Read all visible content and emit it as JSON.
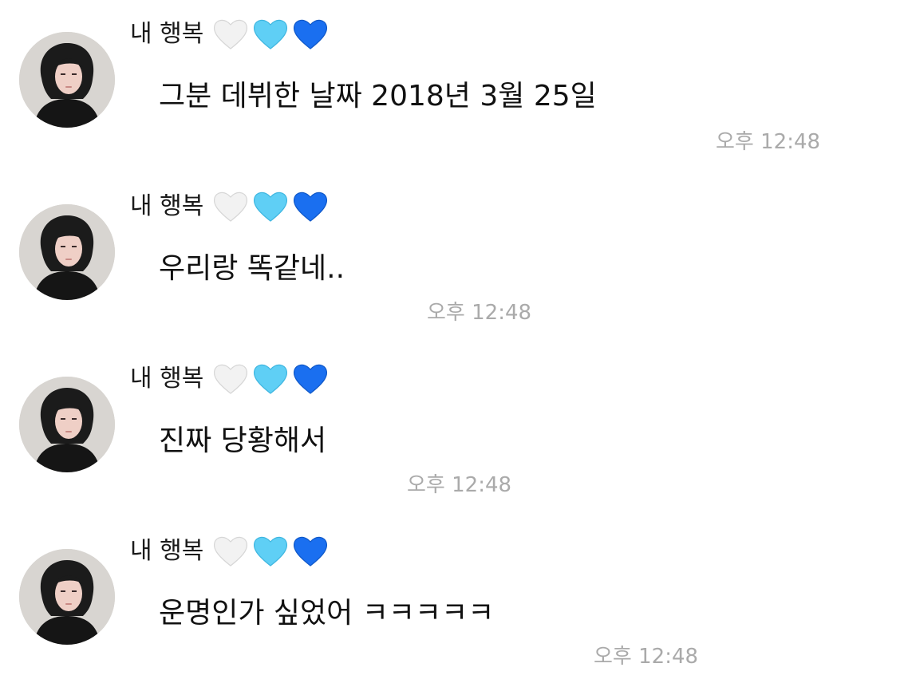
{
  "messages": [
    {
      "sender": "내 행복",
      "hearts": [
        "white-heart-icon",
        "light-blue-heart-icon",
        "blue-heart-icon"
      ],
      "text": "그분 데뷔한 날짜 2018년 3월 25일",
      "time": "오후 12:48"
    },
    {
      "sender": "내 행복",
      "hearts": [
        "white-heart-icon",
        "light-blue-heart-icon",
        "blue-heart-icon"
      ],
      "text": "우리랑 똑같네..",
      "time": "오후 12:48"
    },
    {
      "sender": "내 행복",
      "hearts": [
        "white-heart-icon",
        "light-blue-heart-icon",
        "blue-heart-icon"
      ],
      "text": "진짜 당황해서",
      "time": "오후 12:48"
    },
    {
      "sender": "내 행복",
      "hearts": [
        "white-heart-icon",
        "light-blue-heart-icon",
        "blue-heart-icon"
      ],
      "text": "운명인가 싶었어 ㅋㅋㅋㅋㅋ",
      "time": "오후 12:48"
    }
  ],
  "colors": {
    "background": "#ffffff",
    "timestamp": "#aaaaaa",
    "white_heart": "#f2f2f2",
    "light_blue_heart": "#5fcff5",
    "blue_heart": "#1a6ff0"
  }
}
